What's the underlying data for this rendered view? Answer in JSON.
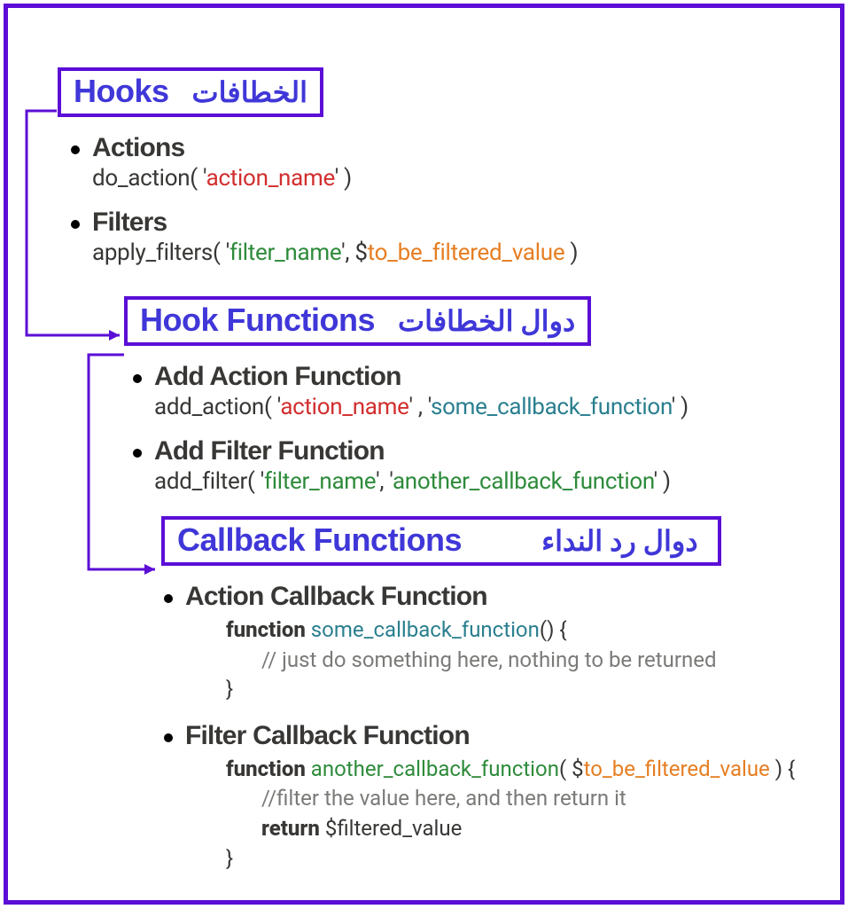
{
  "sections": {
    "hooks": {
      "title_en": "Hooks",
      "title_ar": "الخطافات",
      "items": [
        {
          "label": "Actions",
          "code_prefix": "do_action( '",
          "code_name": "action_name",
          "code_suffix": "' )"
        },
        {
          "label": "Filters",
          "code_prefix": "apply_filters( '",
          "code_name": "filter_name",
          "code_mid": "', $",
          "code_var": "to_be_filtered_value",
          "code_suffix": " )"
        }
      ]
    },
    "hook_functions": {
      "title_en": "Hook Functions",
      "title_ar": "دوال الخطافات",
      "items": [
        {
          "label": "Add Action Function",
          "code_prefix": "add_action( '",
          "code_name": "action_name",
          "code_mid": "' , '",
          "code_cb": "some_callback_function",
          "code_suffix": "' )"
        },
        {
          "label": "Add Filter Function",
          "code_prefix": "add_filter( '",
          "code_name": "filter_name",
          "code_mid": "', '",
          "code_cb": "another_callback_function",
          "code_suffix": "' )"
        }
      ]
    },
    "callback_functions": {
      "title_en": "Callback Functions",
      "title_ar": "دوال رد النداء",
      "items": [
        {
          "label": "Action Callback Function",
          "fn_kw": "function",
          "fn_name": "some_callback_function",
          "fn_params_open": "() {",
          "fn_comment": "// just do something here, nothing to be returned",
          "fn_close": "}"
        },
        {
          "label": "Filter Callback Function",
          "fn_kw": "function",
          "fn_name": "another_callback_function",
          "fn_params_open": "( $",
          "fn_param_var": "to_be_filtered_value",
          "fn_params_close": " ) {",
          "fn_comment": "//filter the value here, and then return it",
          "fn_return_kw": "return",
          "fn_return_val": " $filtered_value",
          "fn_close": "}"
        }
      ]
    }
  }
}
